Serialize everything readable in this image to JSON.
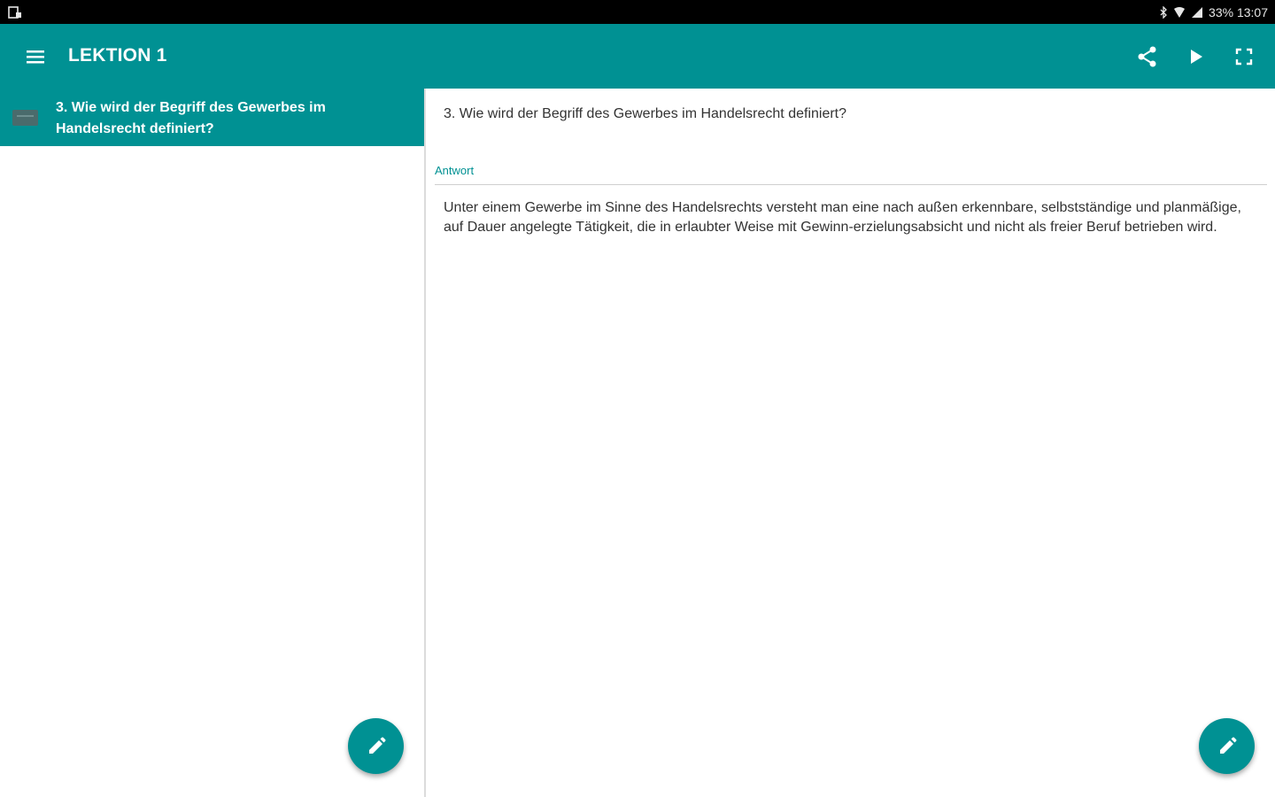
{
  "status_bar": {
    "right_text": "33% 13:07",
    "icons": [
      "notification-icon",
      "bluetooth-icon",
      "wifi-icon",
      "signal-icon",
      "battery-icon"
    ]
  },
  "app_bar": {
    "title": "LEKTION 1",
    "background": "#009193",
    "actions": [
      "share-icon",
      "play-icon",
      "fullscreen-icon"
    ]
  },
  "list": {
    "items": [
      {
        "label": "3. Wie wird der Begriff des Gewerbes im Handelsrecht definiert?",
        "icon": "card-icon",
        "selected": true
      }
    ]
  },
  "detail": {
    "question": "3. Wie wird der Begriff des Gewerbes im Handelsrecht definiert?",
    "answer_label": "Antwort",
    "answer": "Unter einem Gewerbe im Sinne des Handelsrechts versteht man eine nach außen erkennbare, selbstständige und planmäßige, auf Dauer angelegte Tätigkeit, die in erlaubter Weise mit Gewinn-erzielungsabsicht und nicht als freier Beruf betrieben wird."
  },
  "fabs": [
    "edit-icon",
    "edit-icon"
  ],
  "colors": {
    "accent": "#009193",
    "text": "#333333"
  }
}
